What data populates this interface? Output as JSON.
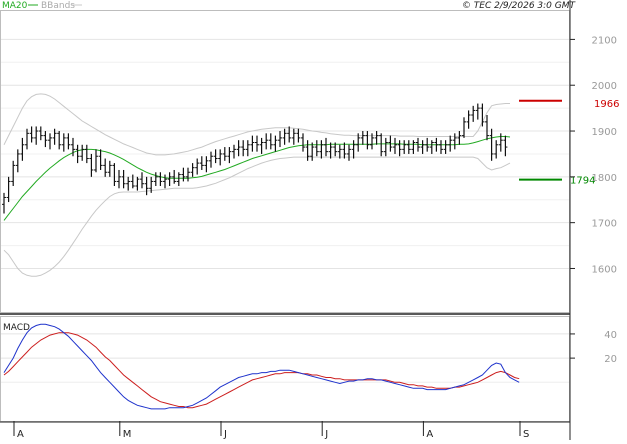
{
  "header": {
    "legend_ma": "MA20",
    "legend_bb": "BBands",
    "timestamp": "© TEC 2/9/2026 3:0 GMT"
  },
  "colors": {
    "price_bar": "#111111",
    "ma20": "#22aa22",
    "bbands": "#c8c8c8",
    "resistance": "#cc0000",
    "support": "#008800",
    "macd": "#1f33cc",
    "signal": "#cc1f1f",
    "grid": "#e4e4e4",
    "tick_text": "#9a9a9a"
  },
  "chart_data": [
    {
      "type": "ohlc",
      "name": "price",
      "x_labels": [
        "A",
        "M",
        "J",
        "J",
        "A",
        "S"
      ],
      "x_label_index": [
        0,
        23,
        45,
        67,
        89,
        110
      ],
      "y_ticks": [
        1600,
        1700,
        1800,
        1900,
        2000,
        2100
      ],
      "y_tick_labels": [
        "1600",
        "1700",
        "1800",
        "1900",
        "2000",
        "2100"
      ],
      "ylim": [
        1505,
        2162
      ],
      "grid": true,
      "bars": [
        [
          1740,
          1765,
          1720,
          1755
        ],
        [
          1755,
          1800,
          1745,
          1790
        ],
        [
          1790,
          1835,
          1780,
          1825
        ],
        [
          1825,
          1860,
          1810,
          1850
        ],
        [
          1850,
          1885,
          1835,
          1870
        ],
        [
          1870,
          1905,
          1860,
          1895
        ],
        [
          1895,
          1910,
          1875,
          1885
        ],
        [
          1885,
          1910,
          1870,
          1900
        ],
        [
          1900,
          1910,
          1880,
          1890
        ],
        [
          1890,
          1900,
          1865,
          1880
        ],
        [
          1880,
          1895,
          1860,
          1885
        ],
        [
          1885,
          1905,
          1870,
          1895
        ],
        [
          1895,
          1900,
          1860,
          1870
        ],
        [
          1870,
          1895,
          1855,
          1885
        ],
        [
          1885,
          1895,
          1860,
          1870
        ],
        [
          1870,
          1885,
          1845,
          1860
        ],
        [
          1860,
          1870,
          1830,
          1845
        ],
        [
          1845,
          1870,
          1835,
          1860
        ],
        [
          1860,
          1870,
          1830,
          1840
        ],
        [
          1840,
          1850,
          1800,
          1815
        ],
        [
          1815,
          1860,
          1810,
          1845
        ],
        [
          1845,
          1860,
          1815,
          1825
        ],
        [
          1825,
          1840,
          1800,
          1810
        ],
        [
          1810,
          1835,
          1800,
          1825
        ],
        [
          1825,
          1830,
          1780,
          1790
        ],
        [
          1790,
          1815,
          1775,
          1800
        ],
        [
          1800,
          1815,
          1775,
          1785
        ],
        [
          1785,
          1800,
          1770,
          1790
        ],
        [
          1790,
          1805,
          1775,
          1780
        ],
        [
          1780,
          1800,
          1770,
          1795
        ],
        [
          1795,
          1810,
          1775,
          1785
        ],
        [
          1785,
          1800,
          1760,
          1775
        ],
        [
          1775,
          1800,
          1765,
          1790
        ],
        [
          1790,
          1810,
          1780,
          1800
        ],
        [
          1800,
          1810,
          1780,
          1790
        ],
        [
          1790,
          1805,
          1775,
          1795
        ],
        [
          1795,
          1810,
          1780,
          1800
        ],
        [
          1800,
          1815,
          1785,
          1790
        ],
        [
          1790,
          1810,
          1780,
          1805
        ],
        [
          1805,
          1820,
          1790,
          1800
        ],
        [
          1800,
          1820,
          1790,
          1810
        ],
        [
          1810,
          1830,
          1800,
          1820
        ],
        [
          1820,
          1840,
          1805,
          1830
        ],
        [
          1830,
          1845,
          1815,
          1825
        ],
        [
          1825,
          1845,
          1810,
          1835
        ],
        [
          1835,
          1855,
          1820,
          1845
        ],
        [
          1845,
          1860,
          1830,
          1840
        ],
        [
          1840,
          1860,
          1825,
          1850
        ],
        [
          1850,
          1865,
          1835,
          1845
        ],
        [
          1845,
          1865,
          1830,
          1855
        ],
        [
          1855,
          1870,
          1840,
          1860
        ],
        [
          1860,
          1880,
          1845,
          1865
        ],
        [
          1865,
          1880,
          1845,
          1860
        ],
        [
          1860,
          1880,
          1845,
          1870
        ],
        [
          1870,
          1890,
          1855,
          1875
        ],
        [
          1875,
          1890,
          1855,
          1870
        ],
        [
          1870,
          1885,
          1850,
          1875
        ],
        [
          1875,
          1895,
          1860,
          1880
        ],
        [
          1880,
          1895,
          1860,
          1870
        ],
        [
          1870,
          1890,
          1855,
          1880
        ],
        [
          1880,
          1900,
          1865,
          1885
        ],
        [
          1885,
          1905,
          1870,
          1895
        ],
        [
          1895,
          1910,
          1875,
          1885
        ],
        [
          1885,
          1905,
          1870,
          1895
        ],
        [
          1895,
          1905,
          1875,
          1885
        ],
        [
          1885,
          1895,
          1855,
          1865
        ],
        [
          1865,
          1880,
          1835,
          1845
        ],
        [
          1845,
          1875,
          1835,
          1865
        ],
        [
          1865,
          1880,
          1845,
          1855
        ],
        [
          1855,
          1880,
          1840,
          1870
        ],
        [
          1870,
          1885,
          1845,
          1855
        ],
        [
          1855,
          1875,
          1840,
          1865
        ],
        [
          1865,
          1875,
          1845,
          1855
        ],
        [
          1855,
          1870,
          1840,
          1860
        ],
        [
          1860,
          1875,
          1840,
          1850
        ],
        [
          1850,
          1870,
          1835,
          1860
        ],
        [
          1860,
          1880,
          1840,
          1870
        ],
        [
          1870,
          1895,
          1855,
          1885
        ],
        [
          1885,
          1900,
          1870,
          1890
        ],
        [
          1890,
          1900,
          1860,
          1870
        ],
        [
          1870,
          1895,
          1860,
          1885
        ],
        [
          1885,
          1900,
          1870,
          1890
        ],
        [
          1890,
          1895,
          1845,
          1855
        ],
        [
          1855,
          1885,
          1845,
          1875
        ],
        [
          1875,
          1890,
          1855,
          1865
        ],
        [
          1865,
          1885,
          1850,
          1870
        ],
        [
          1870,
          1880,
          1845,
          1860
        ],
        [
          1860,
          1880,
          1850,
          1870
        ],
        [
          1870,
          1880,
          1850,
          1860
        ],
        [
          1860,
          1880,
          1850,
          1875
        ],
        [
          1875,
          1885,
          1855,
          1865
        ],
        [
          1865,
          1880,
          1850,
          1870
        ],
        [
          1870,
          1885,
          1855,
          1865
        ],
        [
          1865,
          1880,
          1850,
          1875
        ],
        [
          1875,
          1885,
          1855,
          1870
        ],
        [
          1870,
          1880,
          1850,
          1860
        ],
        [
          1860,
          1880,
          1850,
          1870
        ],
        [
          1870,
          1890,
          1855,
          1880
        ],
        [
          1880,
          1895,
          1860,
          1885
        ],
        [
          1885,
          1900,
          1870,
          1890
        ],
        [
          1890,
          1930,
          1885,
          1920
        ],
        [
          1920,
          1945,
          1905,
          1935
        ],
        [
          1935,
          1955,
          1920,
          1945
        ],
        [
          1945,
          1960,
          1925,
          1950
        ],
        [
          1950,
          1960,
          1910,
          1920
        ],
        [
          1920,
          1935,
          1880,
          1890
        ],
        [
          1890,
          1905,
          1835,
          1850
        ],
        [
          1850,
          1880,
          1840,
          1870
        ],
        [
          1870,
          1895,
          1855,
          1880
        ],
        [
          1880,
          1890,
          1845,
          1865
        ]
      ]
    },
    {
      "type": "line",
      "name": "MA20",
      "values": [
        1705,
        1718,
        1731,
        1744,
        1757,
        1768,
        1779,
        1790,
        1800,
        1810,
        1819,
        1827,
        1835,
        1842,
        1848,
        1853,
        1857,
        1859,
        1860,
        1860,
        1859,
        1857,
        1855,
        1852,
        1848,
        1843,
        1838,
        1832,
        1826,
        1820,
        1815,
        1810,
        1806,
        1803,
        1800,
        1798,
        1797,
        1797,
        1797,
        1797,
        1797,
        1798,
        1799,
        1801,
        1804,
        1807,
        1810,
        1813,
        1816,
        1820,
        1824,
        1828,
        1832,
        1836,
        1840,
        1843,
        1846,
        1849,
        1852,
        1855,
        1858,
        1861,
        1864,
        1866,
        1868,
        1869,
        1870,
        1870,
        1870,
        1870,
        1870,
        1871,
        1871,
        1871,
        1871,
        1871,
        1871,
        1871,
        1871,
        1871,
        1871,
        1872,
        1872,
        1872,
        1872,
        1872,
        1872,
        1871,
        1871,
        1871,
        1871,
        1870,
        1870,
        1870,
        1870,
        1870,
        1870,
        1870,
        1870,
        1871,
        1871,
        1872,
        1874,
        1877,
        1880,
        1883,
        1885,
        1887,
        1888,
        1888,
        1887
      ]
    },
    {
      "type": "band",
      "name": "BBands",
      "upper": [
        1870,
        1890,
        1910,
        1930,
        1950,
        1966,
        1975,
        1980,
        1981,
        1980,
        1976,
        1970,
        1962,
        1954,
        1946,
        1938,
        1930,
        1922,
        1916,
        1910,
        1904,
        1898,
        1892,
        1887,
        1882,
        1877,
        1872,
        1868,
        1864,
        1860,
        1856,
        1852,
        1850,
        1848,
        1848,
        1848,
        1849,
        1850,
        1852,
        1854,
        1856,
        1859,
        1862,
        1865,
        1869,
        1873,
        1877,
        1880,
        1883,
        1886,
        1889,
        1892,
        1895,
        1898,
        1900,
        1902,
        1904,
        1905,
        1906,
        1907,
        1907,
        1907,
        1907,
        1906,
        1905,
        1904,
        1902,
        1900,
        1899,
        1897,
        1896,
        1894,
        1893,
        1892,
        1891,
        1891,
        1890,
        1890,
        1890,
        1890,
        1890,
        1890,
        1890,
        1890,
        1890,
        1890,
        1889,
        1889,
        1889,
        1889,
        1888,
        1888,
        1888,
        1888,
        1888,
        1888,
        1888,
        1888,
        1888,
        1888,
        1888,
        1888,
        1888,
        1900,
        1920,
        1940,
        1955,
        1958,
        1959,
        1960,
        1960
      ],
      "lower": [
        1640,
        1630,
        1615,
        1600,
        1590,
        1585,
        1583,
        1583,
        1585,
        1590,
        1596,
        1604,
        1614,
        1626,
        1640,
        1655,
        1670,
        1686,
        1700,
        1714,
        1727,
        1738,
        1748,
        1757,
        1763,
        1766,
        1767,
        1767,
        1767,
        1767,
        1768,
        1769,
        1770,
        1771,
        1772,
        1773,
        1774,
        1775,
        1775,
        1775,
        1775,
        1775,
        1776,
        1778,
        1780,
        1783,
        1786,
        1790,
        1794,
        1798,
        1803,
        1808,
        1813,
        1818,
        1822,
        1826,
        1830,
        1833,
        1836,
        1838,
        1840,
        1841,
        1842,
        1843,
        1843,
        1843,
        1843,
        1843,
        1843,
        1843,
        1843,
        1843,
        1843,
        1843,
        1843,
        1843,
        1843,
        1843,
        1843,
        1843,
        1843,
        1843,
        1843,
        1843,
        1843,
        1843,
        1843,
        1843,
        1843,
        1843,
        1843,
        1843,
        1843,
        1843,
        1843,
        1843,
        1843,
        1843,
        1843,
        1843,
        1843,
        1843,
        1843,
        1840,
        1830,
        1820,
        1815,
        1818,
        1820,
        1825,
        1830
      ]
    },
    {
      "type": "hline",
      "name": "resistance",
      "value": 1966,
      "label": "1966"
    },
    {
      "type": "hline",
      "name": "support",
      "value": 1794,
      "label": "1794"
    },
    {
      "type": "line",
      "name": "MACD",
      "panel_label": "MACD",
      "y_ticks": [
        20,
        40
      ],
      "y_tick_labels": [
        "20",
        "40"
      ],
      "ylim": [
        -32,
        54
      ],
      "macd": [
        8,
        14,
        20,
        28,
        35,
        41,
        45,
        47,
        48,
        48,
        47,
        46,
        44,
        41,
        38,
        34,
        30,
        26,
        22,
        18,
        13,
        8,
        4,
        0,
        -4,
        -8,
        -12,
        -15,
        -17,
        -19,
        -20,
        -21,
        -22,
        -22,
        -22,
        -22,
        -21,
        -21,
        -21,
        -21,
        -20,
        -19,
        -17,
        -15,
        -13,
        -10,
        -7,
        -4,
        -2,
        0,
        2,
        4,
        5,
        6,
        7,
        7,
        8,
        8,
        9,
        9,
        10,
        10,
        10,
        9,
        8,
        7,
        6,
        5,
        4,
        3,
        2,
        1,
        0,
        -1,
        0,
        1,
        1,
        2,
        2,
        3,
        3,
        2,
        2,
        1,
        0,
        -1,
        -2,
        -3,
        -4,
        -5,
        -5,
        -5,
        -6,
        -6,
        -6,
        -6,
        -6,
        -5,
        -4,
        -3,
        -2,
        0,
        2,
        4,
        6,
        10,
        14,
        16,
        15,
        8,
        4,
        2,
        0
      ],
      "signal": [
        6,
        9,
        13,
        17,
        21,
        25,
        29,
        32,
        35,
        37,
        39,
        40,
        41,
        41,
        41,
        40,
        39,
        37,
        35,
        32,
        29,
        25,
        21,
        18,
        14,
        10,
        6,
        3,
        0,
        -3,
        -6,
        -9,
        -12,
        -14,
        -16,
        -17,
        -18,
        -19,
        -20,
        -20,
        -21,
        -21,
        -20,
        -19,
        -18,
        -16,
        -14,
        -12,
        -10,
        -8,
        -6,
        -4,
        -2,
        0,
        2,
        3,
        4,
        5,
        6,
        7,
        7,
        8,
        8,
        8,
        8,
        7,
        7,
        6,
        6,
        5,
        4,
        4,
        3,
        3,
        2,
        2,
        2,
        2,
        2,
        2,
        2,
        2,
        2,
        2,
        1,
        0,
        0,
        -1,
        -2,
        -2,
        -3,
        -3,
        -4,
        -4,
        -5,
        -5,
        -5,
        -5,
        -4,
        -4,
        -3,
        -2,
        -1,
        0,
        2,
        4,
        6,
        8,
        9,
        8,
        6,
        4,
        3
      ]
    }
  ]
}
